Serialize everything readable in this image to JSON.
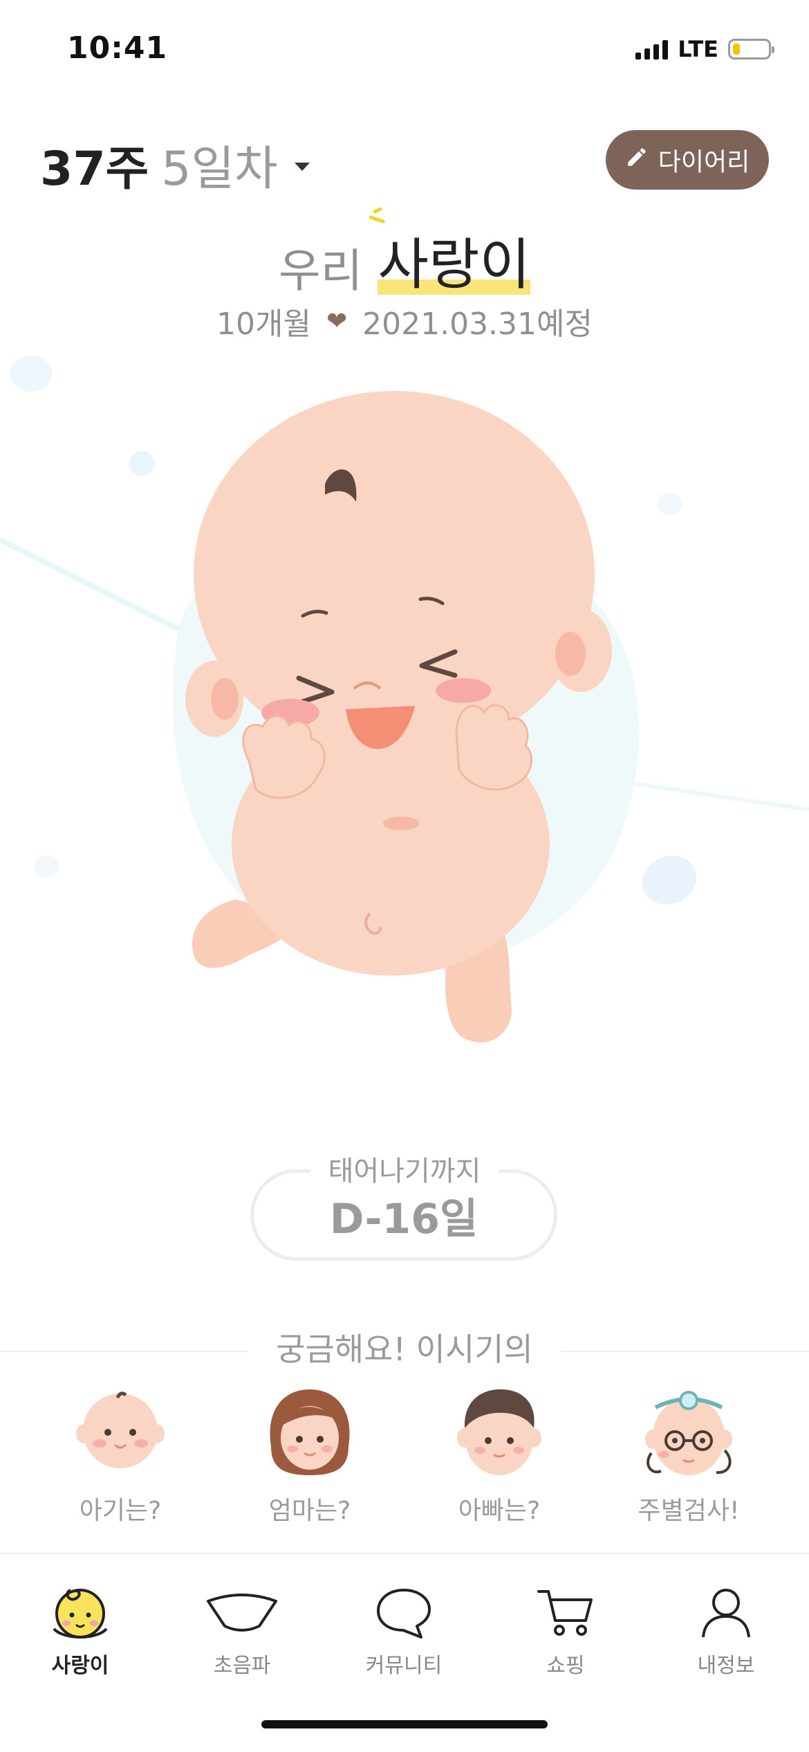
{
  "status": {
    "time": "10:41",
    "network": "LTE",
    "battery_level": 0.18,
    "battery_color": "#f5c400"
  },
  "header": {
    "week": "37주",
    "day": "5일차",
    "diary_button": "다이어리",
    "diary_icon": "pencil-icon",
    "diary_color": "#7e6358"
  },
  "baby": {
    "prefix": "우리",
    "name": "사랑이",
    "months": "10개월",
    "due": "2021.03.31예정",
    "heart_icon": "heart-icon",
    "highlight_color": "#fae47a"
  },
  "dday": {
    "label": "태어나기까지",
    "value": "D-16일"
  },
  "curious": {
    "title": "궁금해요! 이시기의",
    "items": [
      {
        "label": "아기는?",
        "icon": "baby-face-icon"
      },
      {
        "label": "엄마는?",
        "icon": "mom-face-icon"
      },
      {
        "label": "아빠는?",
        "icon": "dad-face-icon"
      },
      {
        "label": "주별검사!",
        "icon": "doctor-face-icon"
      }
    ]
  },
  "tabs": [
    {
      "label": "사랑이",
      "icon": "baby-tab-icon",
      "active": true
    },
    {
      "label": "초음파",
      "icon": "ultrasound-icon",
      "active": false
    },
    {
      "label": "커뮤니티",
      "icon": "chat-bubble-icon",
      "active": false
    },
    {
      "label": "쇼핑",
      "icon": "cart-icon",
      "active": false
    },
    {
      "label": "내정보",
      "icon": "person-icon",
      "active": false
    }
  ]
}
